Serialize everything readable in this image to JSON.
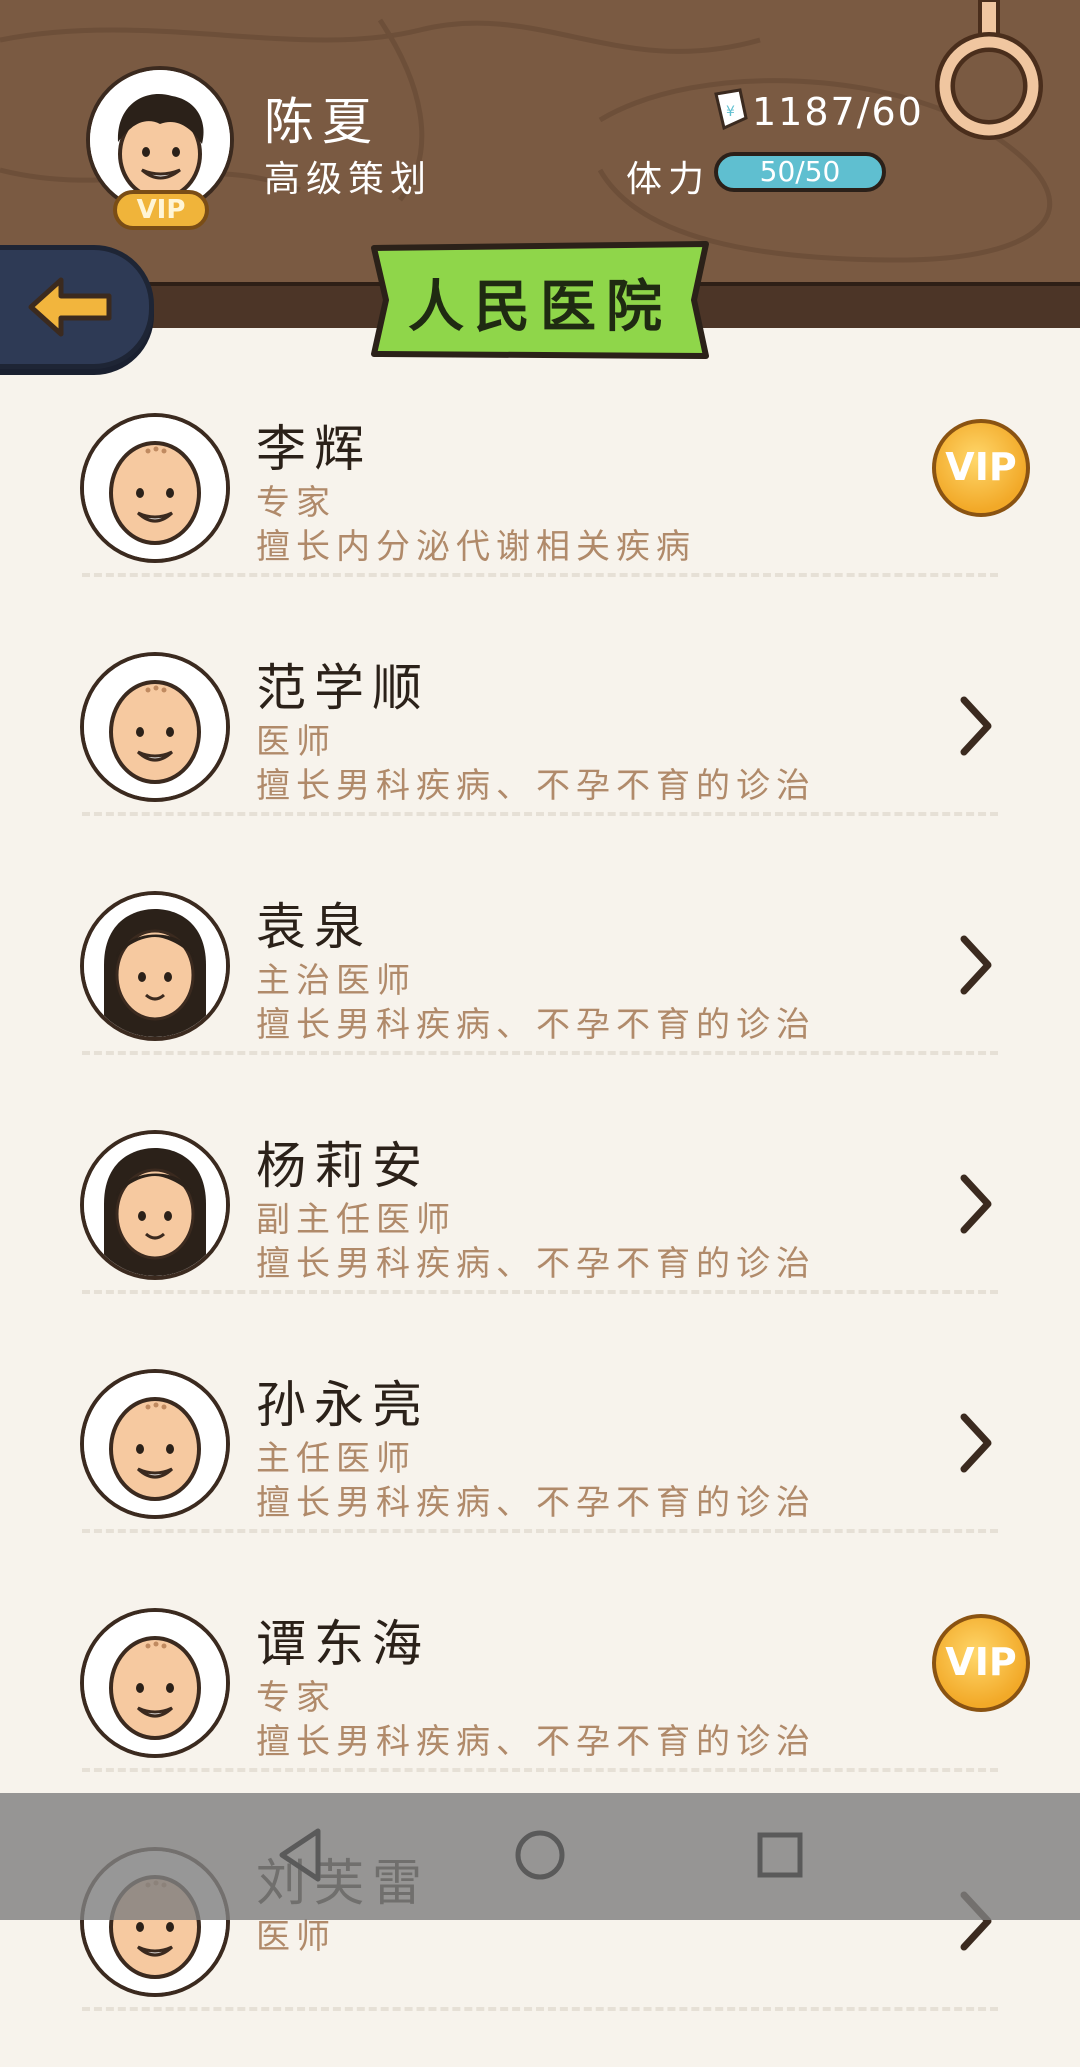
{
  "player": {
    "name": "陈夏",
    "title": "高级策划",
    "vip_label": "VIP",
    "money": "1187/60",
    "stamina_label": "体力",
    "stamina_value": "50/50"
  },
  "banner": {
    "title": "人民医院"
  },
  "doctors": [
    {
      "name": "李辉",
      "rank": "专家",
      "desc": "擅长内分泌代谢相关疾病",
      "badge": "VIP",
      "avatar": "bald-man"
    },
    {
      "name": "范学顺",
      "rank": "医师",
      "desc": "擅长男科疾病、不孕不育的诊治",
      "badge": "",
      "avatar": "bald-man"
    },
    {
      "name": "袁泉",
      "rank": "主治医师",
      "desc": "擅长男科疾病、不孕不育的诊治",
      "badge": "",
      "avatar": "woman"
    },
    {
      "name": "杨莉安",
      "rank": "副主任医师",
      "desc": "擅长男科疾病、不孕不育的诊治",
      "badge": "",
      "avatar": "woman"
    },
    {
      "name": "孙永亮",
      "rank": "主任医师",
      "desc": "擅长男科疾病、不孕不育的诊治",
      "badge": "",
      "avatar": "bald-man"
    },
    {
      "name": "谭东海",
      "rank": "专家",
      "desc": "擅长男科疾病、不孕不育的诊治",
      "badge": "VIP",
      "avatar": "bald-man"
    },
    {
      "name": "刘芙雷",
      "rank": "医师",
      "desc": "",
      "badge": "",
      "avatar": "bald-man"
    }
  ],
  "icons": {
    "back": "back-arrow-icon",
    "ticket": "ticket-icon",
    "ring": "ring-icon",
    "chevron": "chevron-right-icon",
    "nav_back": "nav-back-icon",
    "nav_home": "nav-home-icon",
    "nav_recent": "nav-recent-icon"
  },
  "colors": {
    "header_wood": "#7a5a42",
    "banner_green": "#8fd64a",
    "stamina_blue": "#5fbfd0",
    "vip_gold": "#f2a928",
    "text_brown": "#b08a6a"
  }
}
